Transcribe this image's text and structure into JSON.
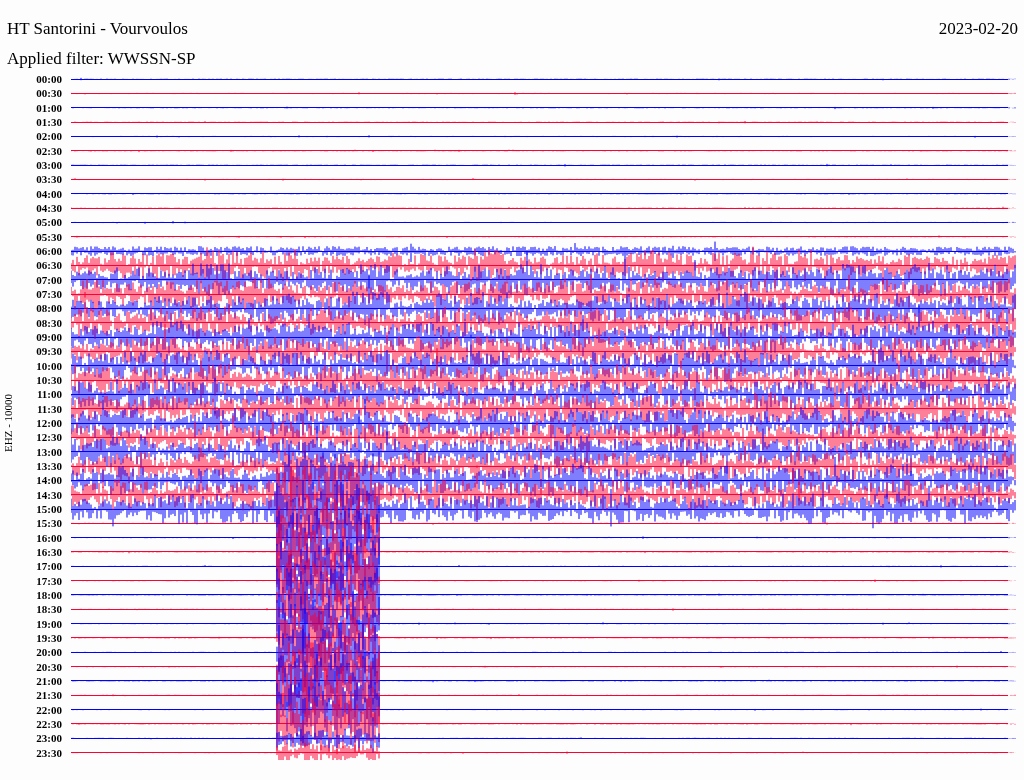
{
  "header": {
    "station": "HT Santorini - Vourvoulos",
    "date": "2023-02-20"
  },
  "filter_label": "Applied filter: WWSSN-SP",
  "channel_label": "EHZ - 10000",
  "rows": [
    {
      "time": "00:00",
      "color": "#0000ff"
    },
    {
      "time": "00:30",
      "color": "#ff0033"
    },
    {
      "time": "01:00",
      "color": "#0000ff"
    },
    {
      "time": "01:30",
      "color": "#ff0033"
    },
    {
      "time": "02:00",
      "color": "#0000ff"
    },
    {
      "time": "02:30",
      "color": "#ff0033"
    },
    {
      "time": "03:00",
      "color": "#0000ff"
    },
    {
      "time": "03:30",
      "color": "#ff0033"
    },
    {
      "time": "04:00",
      "color": "#0000ff"
    },
    {
      "time": "04:30",
      "color": "#ff0033"
    },
    {
      "time": "05:00",
      "color": "#0000ff"
    },
    {
      "time": "05:30",
      "color": "#ff0033"
    },
    {
      "time": "06:00",
      "color": "#0000ff"
    },
    {
      "time": "06:30",
      "color": "#ff0033"
    },
    {
      "time": "07:00",
      "color": "#0000ff"
    },
    {
      "time": "07:30",
      "color": "#ff0033"
    },
    {
      "time": "08:00",
      "color": "#0000ff"
    },
    {
      "time": "08:30",
      "color": "#ff0033"
    },
    {
      "time": "09:00",
      "color": "#0000ff"
    },
    {
      "time": "09:30",
      "color": "#ff0033"
    },
    {
      "time": "10:00",
      "color": "#0000ff"
    },
    {
      "time": "10:30",
      "color": "#ff0033"
    },
    {
      "time": "11:00",
      "color": "#0000ff"
    },
    {
      "time": "11:30",
      "color": "#ff0033"
    },
    {
      "time": "12:00",
      "color": "#0000ff"
    },
    {
      "time": "12:30",
      "color": "#ff0033"
    },
    {
      "time": "13:00",
      "color": "#0000ff"
    },
    {
      "time": "13:30",
      "color": "#ff0033"
    },
    {
      "time": "14:00",
      "color": "#0000ff"
    },
    {
      "time": "14:30",
      "color": "#ff0033"
    },
    {
      "time": "15:00",
      "color": "#0000ff"
    },
    {
      "time": "15:30",
      "color": "#ff0033"
    },
    {
      "time": "16:00",
      "color": "#0000ff"
    },
    {
      "time": "16:30",
      "color": "#ff0033"
    },
    {
      "time": "17:00",
      "color": "#0000ff"
    },
    {
      "time": "17:30",
      "color": "#ff0033"
    },
    {
      "time": "18:00",
      "color": "#0000ff"
    },
    {
      "time": "18:30",
      "color": "#ff0033"
    },
    {
      "time": "19:00",
      "color": "#0000ff"
    },
    {
      "time": "19:30",
      "color": "#ff0033"
    },
    {
      "time": "20:00",
      "color": "#0000ff"
    },
    {
      "time": "20:30",
      "color": "#ff0033"
    },
    {
      "time": "21:00",
      "color": "#0000ff"
    },
    {
      "time": "21:30",
      "color": "#ff0033"
    },
    {
      "time": "22:00",
      "color": "#0000ff"
    },
    {
      "time": "22:30",
      "color": "#ff0033"
    },
    {
      "time": "23:00",
      "color": "#0000ff"
    },
    {
      "time": "23:30",
      "color": "#ff0033"
    }
  ]
}
